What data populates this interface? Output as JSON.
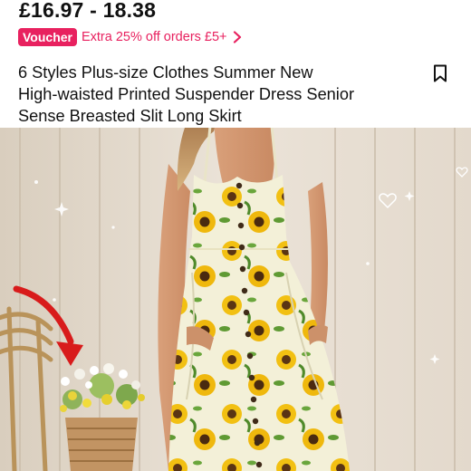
{
  "product": {
    "price_range": "£16.97 - 18.38",
    "voucher": {
      "badge": "Voucher",
      "text": "Extra 25% off orders £5+",
      "chevron_icon": "chevron-right-icon",
      "color": "#e8215f"
    },
    "title_lines": [
      "6 Styles Plus-size Clothes  Summer New",
      "High-waisted Printed Suspender Dress Senior",
      "Sense Breasted Slit Long Skirt"
    ],
    "bookmark_icon": "bookmark-icon"
  },
  "photo": {
    "subject": "model wearing cream sunflower-print button-front dress",
    "annotation_arrow_color": "#d81b1b"
  }
}
